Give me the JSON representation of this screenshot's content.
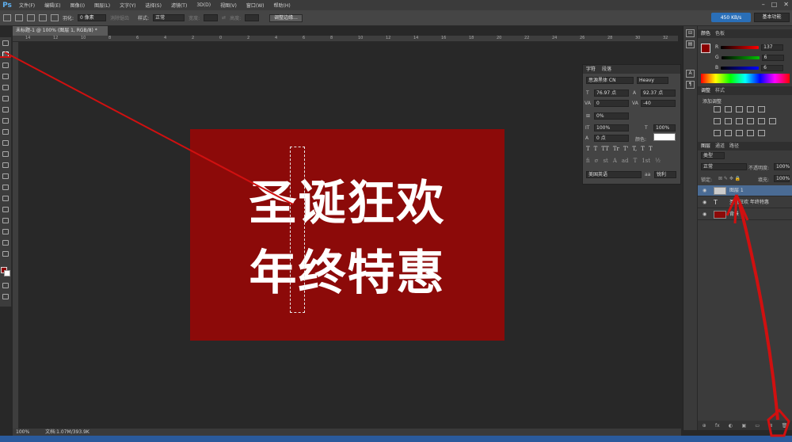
{
  "app": {
    "logo": "Ps"
  },
  "menu": [
    "文件(F)",
    "编辑(E)",
    "图像(I)",
    "图层(L)",
    "文字(Y)",
    "选择(S)",
    "滤镜(T)",
    "3D(D)",
    "视图(V)",
    "窗口(W)",
    "帮助(H)"
  ],
  "options": {
    "feather_label": "羽化:",
    "feather_value": "0 像素",
    "antialias_label": "消除锯齿",
    "style_label": "样式:",
    "style_value": "正常",
    "width_label": "宽度:",
    "height_label": "高度:",
    "refine_edge_button": "调整边缘...",
    "net_speed": "450 KB/s",
    "workspace": "基本功能"
  },
  "document": {
    "tab_title": "未标题-1 @ 100% (图层 1, RGB/8) *"
  },
  "rulers": {
    "top": [
      "14",
      "12",
      "10",
      "8",
      "6",
      "4",
      "2",
      "0",
      "2",
      "4",
      "6",
      "8",
      "10",
      "12",
      "14",
      "16",
      "18",
      "20",
      "22",
      "24",
      "26",
      "28",
      "30",
      "32"
    ]
  },
  "artwork": {
    "line1": "圣诞狂欢",
    "line2": "年终特惠"
  },
  "character_panel": {
    "tabs": [
      "字符",
      "段落"
    ],
    "font_family": "思源黑体 CN",
    "font_style": "Heavy",
    "font_size": "76.97 点",
    "leading": "92.37 点",
    "kerning": "0",
    "tracking": "-40",
    "scale_percent": "0%",
    "vertical_scale": "100%",
    "horizontal_scale": "100%",
    "baseline_shift": "0 点",
    "color_label": "颜色:",
    "language": "美国英语",
    "antialias": "锐利",
    "style_buttons": [
      "T",
      "T",
      "TT",
      "Tr",
      "T'",
      "T,",
      "T",
      "T"
    ],
    "opentype_buttons": [
      "fi",
      "σ",
      "st",
      "A",
      "ad",
      "T",
      "1st",
      "½"
    ]
  },
  "color_panel": {
    "tabs": [
      "颜色",
      "色板"
    ],
    "channels": [
      {
        "label": "R",
        "value": "137",
        "gradient": "#ff0000"
      },
      {
        "label": "G",
        "value": "6",
        "gradient": "#00c000"
      },
      {
        "label": "B",
        "value": "6",
        "gradient": "#0000ff"
      }
    ]
  },
  "adjustments_panel": {
    "tabs": [
      "调整",
      "样式"
    ],
    "add_label": "添加调整"
  },
  "layers_panel": {
    "tabs": [
      "图层",
      "通道",
      "路径"
    ],
    "filter_label": "类型",
    "blend_mode": "正常",
    "opacity_label": "不透明度:",
    "opacity_value": "100%",
    "lock_label": "锁定:",
    "fill_label": "填充:",
    "fill_value": "100%",
    "layers": [
      {
        "name": "图层 1",
        "thumb_color": "#cccccc",
        "selected": true
      },
      {
        "name": "圣诞狂欢 年终特惠",
        "type": "text",
        "thumb_color": "#444444",
        "selected": false
      },
      {
        "name": "背景",
        "thumb_color": "#8c0a09",
        "selected": false
      }
    ],
    "footer_icons": [
      "⊕",
      "fx",
      "◐",
      "▣",
      "▭",
      "⊞",
      "🗑"
    ]
  },
  "status": {
    "zoom": "100%",
    "doc_size": "文档:1.07M/393.9K"
  },
  "colors": {
    "accent_red": "#8c0a09",
    "annotation_red": "#d01010"
  }
}
